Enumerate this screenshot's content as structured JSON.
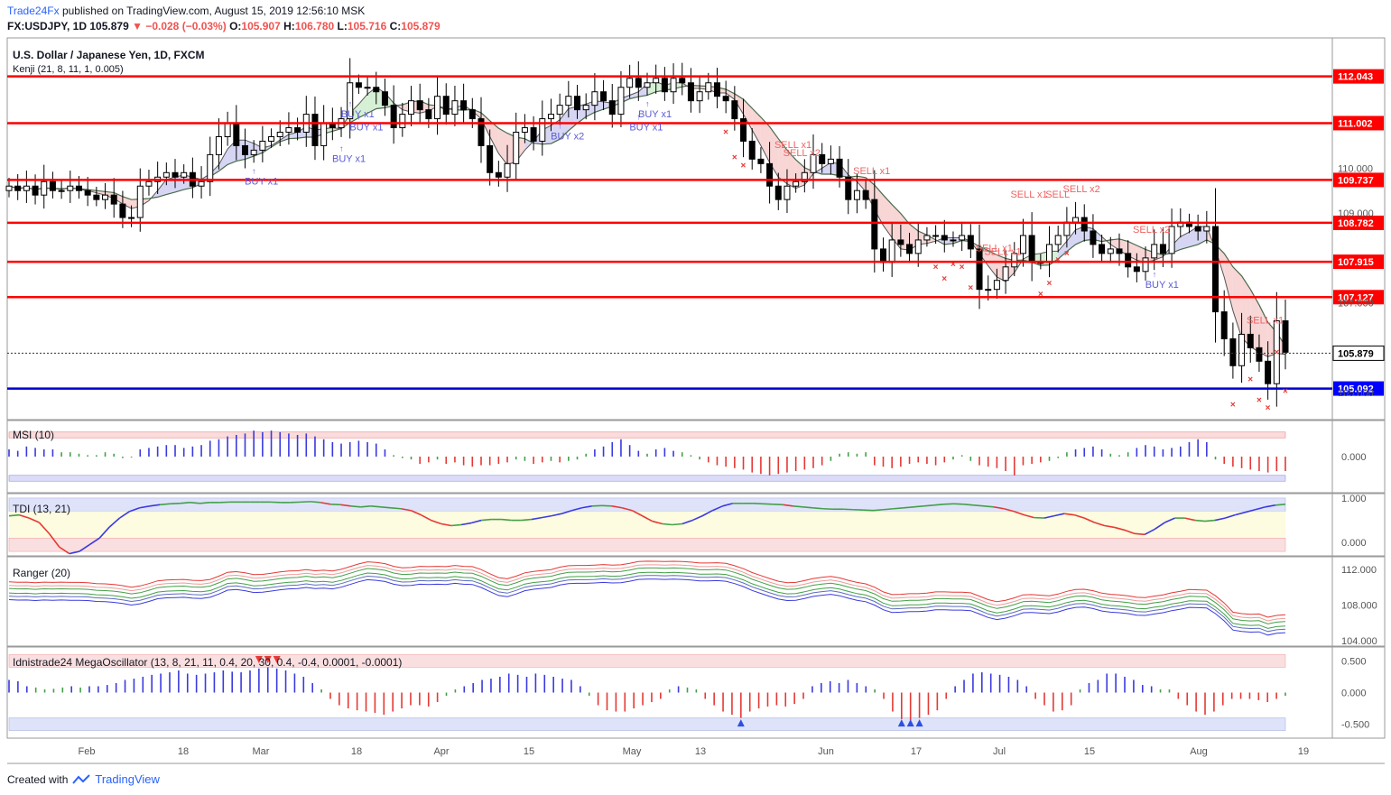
{
  "header": {
    "publisher": "Trade24Fx",
    "published_text": "published on TradingView.com, August 15, 2019 12:56:10 MSK",
    "symbol": "FX:USDJPY, 1D",
    "last": "105.879",
    "change": "▼ −0.028 (−0.03%)",
    "o_label": "O:",
    "o": "105.907",
    "h_label": "H:",
    "h": "106.780",
    "l_label": "L:",
    "l": "105.716",
    "c_label": "C:",
    "c": "105.879"
  },
  "footer": {
    "created_with": "Created with",
    "brand": "TradingView"
  },
  "colors": {
    "up_candle": "#ffffff",
    "down_candle": "#000000",
    "level_line": "#ff0000",
    "support_line": "#0000cc",
    "price_tag": "#ff0000",
    "support_tag": "#0000ff",
    "buy_text": "#5b5bd6",
    "sell_text": "#f06262",
    "kenji_fast": "#555555",
    "kenji_cloud_up": "#c8c8f0",
    "kenji_cloud_down": "#f5c8c8",
    "kenji_cloud_green": "#c8ebc8"
  },
  "chart_data": [
    {
      "type": "candlestick",
      "title": "U.S. Dollar / Japanese Yen, 1D, FXCM",
      "indicator_label": "Kenji (21, 8, 11, 1, 0.005)",
      "ylim": [
        104.4,
        112.9
      ],
      "price_axis_ticks": [
        "110.000",
        "109.000",
        "107.000",
        "105.000"
      ],
      "x_ticks": [
        "Feb",
        "18",
        "Mar",
        "18",
        "Apr",
        "15",
        "May",
        "13",
        "Jun",
        "17",
        "Jul",
        "15",
        "Aug",
        "19"
      ],
      "levels": [
        {
          "value": 112.043,
          "label": "112.043",
          "color": "red"
        },
        {
          "value": 111.002,
          "label": "111.002",
          "color": "red"
        },
        {
          "value": 109.737,
          "label": "109.737",
          "color": "red"
        },
        {
          "value": 108.782,
          "label": "108.782",
          "color": "red"
        },
        {
          "value": 107.915,
          "label": "107.915",
          "color": "red"
        },
        {
          "value": 107.127,
          "label": "107.127",
          "color": "red"
        },
        {
          "value": 105.092,
          "label": "105.092",
          "color": "blue"
        }
      ],
      "last_price": {
        "value": 105.879,
        "label": "105.879"
      },
      "close": [
        109.6,
        109.5,
        109.6,
        109.4,
        109.7,
        109.5,
        109.5,
        109.6,
        109.5,
        109.4,
        109.3,
        109.4,
        109.2,
        108.9,
        108.9,
        109.6,
        109.7,
        109.8,
        109.9,
        109.8,
        109.9,
        109.6,
        109.7,
        110.3,
        110.7,
        111.0,
        110.5,
        110.3,
        110.4,
        110.6,
        110.7,
        110.8,
        110.9,
        110.8,
        111.2,
        110.5,
        111.0,
        110.9,
        111.1,
        111.9,
        111.8,
        111.8,
        111.7,
        111.4,
        110.9,
        111.2,
        111.5,
        111.3,
        111.1,
        111.6,
        111.2,
        111.5,
        111.3,
        111.1,
        110.5,
        109.9,
        109.8,
        110.1,
        110.8,
        110.9,
        110.6,
        111.1,
        111.2,
        111.4,
        111.6,
        111.3,
        111.4,
        111.7,
        111.5,
        111.2,
        111.8,
        112.0,
        111.8,
        111.9,
        112.0,
        111.7,
        112.0,
        111.9,
        111.5,
        111.7,
        111.9,
        111.6,
        111.5,
        111.1,
        110.6,
        110.2,
        110.1,
        109.6,
        109.3,
        109.6,
        109.7,
        109.9,
        110.3,
        110.1,
        110.2,
        109.8,
        109.3,
        109.5,
        109.3,
        108.2,
        107.9,
        108.4,
        108.3,
        108.1,
        108.4,
        108.5,
        108.5,
        108.4,
        108.4,
        108.5,
        108.2,
        107.3,
        107.3,
        107.5,
        107.8,
        108.1,
        108.5,
        107.9,
        107.9,
        108.3,
        108.5,
        108.8,
        108.9,
        108.6,
        108.3,
        108.1,
        108.2,
        108.1,
        107.8,
        107.7,
        108.0,
        108.3,
        108.1,
        108.7,
        108.8,
        108.7,
        108.6,
        108.7,
        106.8,
        106.2,
        105.6,
        106.3,
        106.0,
        105.7,
        105.2,
        106.6,
        105.9
      ]
    },
    {
      "type": "bar",
      "title": "MSI (10)",
      "ylim": [
        -0.25,
        0.25
      ],
      "axis_ticks": [
        "0.000"
      ],
      "values": [
        0.05,
        0.04,
        0.07,
        0.06,
        0.05,
        0.05,
        0.03,
        0.03,
        0.02,
        0.01,
        0.01,
        0.03,
        0.02,
        -0.01,
        0.0,
        0.05,
        0.06,
        0.07,
        0.08,
        0.08,
        0.06,
        0.07,
        0.08,
        0.11,
        0.12,
        0.14,
        0.15,
        0.16,
        0.18,
        0.17,
        0.18,
        0.17,
        0.16,
        0.15,
        0.16,
        0.14,
        0.12,
        0.1,
        0.09,
        0.1,
        0.11,
        0.1,
        0.09,
        0.05,
        0.01,
        -0.01,
        -0.02,
        -0.05,
        -0.04,
        -0.02,
        -0.05,
        -0.04,
        -0.06,
        -0.07,
        -0.06,
        -0.06,
        -0.05,
        -0.04,
        -0.02,
        -0.03,
        -0.05,
        -0.04,
        -0.03,
        -0.04,
        -0.03,
        -0.02,
        0.02,
        0.05,
        0.07,
        0.1,
        0.12,
        0.08,
        0.04,
        0.02,
        0.05,
        0.06,
        0.04,
        0.03,
        0.01,
        -0.02,
        -0.04,
        -0.06,
        -0.07,
        -0.08,
        -0.09,
        -0.11,
        -0.12,
        -0.13,
        -0.12,
        -0.11,
        -0.1,
        -0.09,
        -0.08,
        -0.06,
        -0.03,
        0.02,
        0.03,
        0.02,
        0.03,
        -0.06,
        -0.07,
        -0.08,
        -0.07,
        -0.05,
        -0.04,
        -0.05,
        -0.06,
        -0.04,
        -0.02,
        0.01,
        -0.03,
        -0.06,
        -0.07,
        -0.08,
        -0.1,
        -0.13,
        -0.06,
        -0.05,
        -0.04,
        -0.03,
        -0.01,
        0.03,
        0.05,
        0.06,
        0.07,
        0.05,
        0.02,
        0.01,
        0.03,
        0.06,
        0.08,
        0.07,
        0.05,
        0.06,
        0.07,
        0.1,
        0.12,
        0.1,
        -0.02,
        -0.05,
        -0.07,
        -0.08,
        -0.09,
        -0.1,
        -0.11,
        -0.1,
        -0.1
      ]
    },
    {
      "type": "line",
      "title": "TDI (13, 21)",
      "ylim": [
        -0.3,
        1.1
      ],
      "axis_ticks": [
        "1.000",
        "0.000"
      ],
      "values": [
        0.6,
        0.62,
        0.55,
        0.45,
        0.2,
        -0.1,
        -0.25,
        -0.2,
        -0.05,
        0.1,
        0.35,
        0.55,
        0.7,
        0.78,
        0.82,
        0.85,
        0.87,
        0.88,
        0.9,
        0.88,
        0.9,
        0.9,
        0.91,
        0.91,
        0.91,
        0.91,
        0.91,
        0.9,
        0.9,
        0.91,
        0.92,
        0.9,
        0.86,
        0.85,
        0.82,
        0.8,
        0.82,
        0.8,
        0.78,
        0.76,
        0.72,
        0.62,
        0.5,
        0.42,
        0.38,
        0.4,
        0.44,
        0.5,
        0.52,
        0.52,
        0.5,
        0.5,
        0.52,
        0.56,
        0.6,
        0.65,
        0.72,
        0.78,
        0.82,
        0.83,
        0.82,
        0.78,
        0.72,
        0.6,
        0.48,
        0.42,
        0.4,
        0.42,
        0.5,
        0.6,
        0.72,
        0.82,
        0.88,
        0.88,
        0.88,
        0.87,
        0.86,
        0.85,
        0.82,
        0.8,
        0.78,
        0.76,
        0.75,
        0.75,
        0.74,
        0.73,
        0.72,
        0.74,
        0.76,
        0.78,
        0.8,
        0.82,
        0.84,
        0.86,
        0.87,
        0.86,
        0.84,
        0.82,
        0.8,
        0.76,
        0.7,
        0.62,
        0.56,
        0.55,
        0.6,
        0.65,
        0.62,
        0.55,
        0.45,
        0.38,
        0.34,
        0.28,
        0.2,
        0.18,
        0.3,
        0.45,
        0.55,
        0.55,
        0.5,
        0.48,
        0.5,
        0.55,
        0.62,
        0.68,
        0.74,
        0.8,
        0.84,
        0.86
      ]
    },
    {
      "type": "line",
      "title": "Ranger (20)",
      "ylim": [
        103.4,
        113.4
      ],
      "axis_ticks": [
        "112.000",
        "108.000",
        "104.000"
      ],
      "close": [
        109.6,
        109.5,
        109.6,
        109.4,
        109.7,
        109.5,
        109.5,
        109.6,
        109.5,
        109.4,
        109.3,
        109.4,
        109.2,
        108.9,
        108.9,
        109.6,
        109.7,
        109.8,
        109.9,
        109.8,
        109.9,
        109.6,
        109.7,
        110.3,
        110.7,
        111.0,
        110.5,
        110.3,
        110.4,
        110.6,
        110.7,
        110.8,
        110.9,
        110.8,
        111.2,
        110.5,
        111.0,
        110.9,
        111.1,
        111.9,
        111.8,
        111.8,
        111.7,
        111.4,
        110.9,
        111.2,
        111.5,
        111.3,
        111.1,
        111.6,
        111.2,
        111.5,
        111.3,
        111.1,
        110.5,
        109.9,
        109.8,
        110.1,
        110.8,
        110.9,
        110.6,
        111.1,
        111.2,
        111.4,
        111.6,
        111.3,
        111.4,
        111.7,
        111.5,
        111.2,
        111.8,
        112.0,
        111.8,
        111.9,
        112.0,
        111.7,
        112.0,
        111.9,
        111.5,
        111.7,
        111.9,
        111.6,
        111.5,
        111.1,
        110.6,
        110.2,
        110.1,
        109.6,
        109.3,
        109.6,
        109.7,
        109.9,
        110.3,
        110.1,
        110.2,
        109.8,
        109.3,
        109.5,
        109.3,
        108.2,
        107.9,
        108.4,
        108.3,
        108.1,
        108.4,
        108.5,
        108.5,
        108.4,
        108.4,
        108.5,
        108.2,
        107.3,
        107.3,
        107.5,
        107.8,
        108.1,
        108.5,
        107.9,
        107.9,
        108.3,
        108.5,
        108.8,
        108.9,
        108.6,
        108.3,
        108.1,
        108.2,
        108.1,
        107.8,
        107.7,
        108.0,
        108.3,
        108.1,
        108.7,
        108.8,
        108.7,
        108.6,
        108.7,
        106.8,
        106.2,
        105.6,
        106.3,
        106.0,
        105.7,
        105.2,
        106.6,
        105.9
      ]
    },
    {
      "type": "bar",
      "title": "Idnistrade24 MegaOscillator (13, 8, 21, 11, 0.4, 20, 30, 0.4, -0.4, 0.0001, -0.0001)",
      "ylim": [
        -0.72,
        0.72
      ],
      "axis_ticks": [
        "0.500",
        "0.000",
        "-0.500"
      ],
      "values": [
        0.2,
        0.18,
        0.1,
        0.08,
        0.05,
        0.06,
        0.08,
        0.1,
        0.08,
        0.1,
        0.1,
        0.12,
        0.15,
        0.2,
        0.22,
        0.25,
        0.28,
        0.3,
        0.32,
        0.35,
        0.3,
        0.28,
        0.3,
        0.32,
        0.35,
        0.33,
        0.32,
        0.35,
        0.38,
        0.4,
        0.38,
        0.35,
        0.3,
        0.25,
        0.15,
        0.05,
        -0.1,
        -0.2,
        -0.25,
        -0.28,
        -0.3,
        -0.32,
        -0.35,
        -0.3,
        -0.25,
        -0.2,
        -0.2,
        -0.22,
        -0.15,
        -0.05,
        0.05,
        0.1,
        0.15,
        0.2,
        0.22,
        0.25,
        0.3,
        0.28,
        0.25,
        0.3,
        0.28,
        0.25,
        0.22,
        0.2,
        0.1,
        -0.05,
        -0.2,
        -0.28,
        -0.3,
        -0.3,
        -0.25,
        -0.2,
        -0.15,
        -0.1,
        0.05,
        0.1,
        0.08,
        0.05,
        -0.1,
        -0.2,
        -0.3,
        -0.35,
        -0.4,
        -0.3,
        -0.25,
        -0.22,
        -0.2,
        -0.22,
        -0.18,
        -0.1,
        0.1,
        0.15,
        0.18,
        0.15,
        0.2,
        0.15,
        0.1,
        0.05,
        -0.1,
        -0.3,
        -0.42,
        -0.44,
        -0.4,
        -0.35,
        -0.28,
        -0.1,
        0.1,
        0.2,
        0.3,
        0.32,
        0.3,
        0.28,
        0.25,
        0.2,
        0.1,
        -0.1,
        -0.2,
        -0.3,
        -0.28,
        -0.2,
        0.05,
        0.15,
        0.2,
        0.3,
        0.3,
        0.25,
        0.2,
        0.12,
        0.1,
        0.05,
        0.05,
        -0.1,
        -0.2,
        -0.3,
        -0.35,
        -0.3,
        -0.2,
        -0.1,
        -0.1,
        -0.1,
        -0.12,
        -0.15,
        -0.1,
        -0.05
      ]
    }
  ],
  "signals": {
    "buy_labels": [
      "BUY x1",
      "BUY x1",
      "BUY x1",
      "BUY x1",
      "BUY x2",
      "BUY x1",
      "BUY x1",
      "BUY x1"
    ],
    "sell_labels": [
      "SELL x2",
      "SELL x1",
      "SELL x1",
      "SELL x1",
      "SELL x1",
      "SELL x1",
      "SELL x2",
      "SELL",
      "SELL x2",
      "SELL x1"
    ]
  }
}
